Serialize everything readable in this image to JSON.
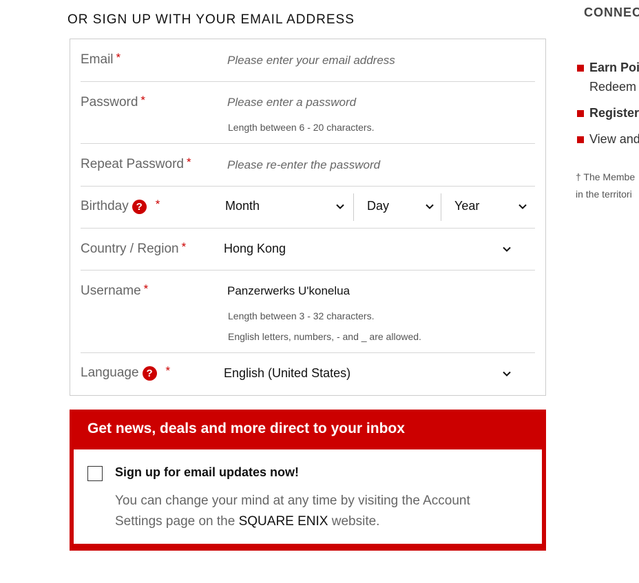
{
  "section_title": "OR SIGN UP WITH YOUR EMAIL ADDRESS",
  "required_mark": "*",
  "help_glyph": "?",
  "form": {
    "email": {
      "label": "Email",
      "placeholder": "Please enter your email address",
      "value": ""
    },
    "password": {
      "label": "Password",
      "placeholder": "Please enter a password",
      "value": "",
      "hint": "Length between 6 - 20 characters."
    },
    "repeat_password": {
      "label": "Repeat Password",
      "placeholder": "Please re-enter the password",
      "value": ""
    },
    "birthday": {
      "label": "Birthday",
      "month": "Month",
      "day": "Day",
      "year": "Year"
    },
    "country": {
      "label": "Country / Region",
      "value": "Hong Kong"
    },
    "username": {
      "label": "Username",
      "value": "Panzerwerks U'konelua",
      "hint1": "Length between 3 - 32 characters.",
      "hint2": "English letters, numbers, - and _ are allowed."
    },
    "language": {
      "label": "Language",
      "value": "English (United States)"
    }
  },
  "newsletter": {
    "title": "Get news, deals and more direct to your inbox",
    "checkbox_label": "Sign up for email updates now!",
    "checked": false,
    "desc_before": "You can change your mind at any time by visiting the Account Settings page on the ",
    "desc_brand": "SQUARE ENIX",
    "desc_after": " website."
  },
  "sidebar": {
    "title": "CONNEC",
    "items": [
      {
        "bold": "Earn Poir",
        "line2": "Redeem"
      },
      {
        "bold": "Register",
        "line2": ""
      },
      {
        "bold": "",
        "text": "View and"
      }
    ],
    "note_line1": "† The Membe",
    "note_line2": "in the territori"
  },
  "colors": {
    "accent": "#cc0000",
    "label": "#666666",
    "border": "#cccccc"
  }
}
